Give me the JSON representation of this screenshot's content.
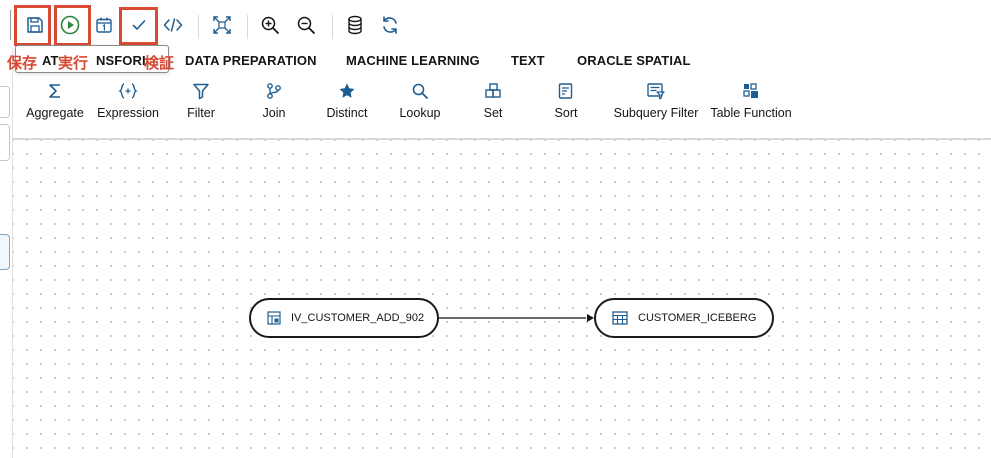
{
  "annotations": {
    "save": "保存",
    "run": "実行",
    "validate": "検証"
  },
  "tabs": [
    "AT",
    "NSFORI",
    "DATA PREPARATION",
    "MACHINE LEARNING",
    "TEXT",
    "ORACLE SPATIAL"
  ],
  "palette": [
    {
      "label": "Aggregate",
      "icon": "sigma-icon"
    },
    {
      "label": "Expression",
      "icon": "expression-icon"
    },
    {
      "label": "Filter",
      "icon": "filter-icon"
    },
    {
      "label": "Join",
      "icon": "join-icon"
    },
    {
      "label": "Distinct",
      "icon": "star-icon"
    },
    {
      "label": "Lookup",
      "icon": "search-icon"
    },
    {
      "label": "Set",
      "icon": "set-icon"
    },
    {
      "label": "Sort",
      "icon": "sort-icon"
    },
    {
      "label": "Subquery Filter",
      "icon": "subquery-filter-icon"
    },
    {
      "label": "Table Function",
      "icon": "table-function-icon"
    }
  ],
  "nodes": {
    "source": "IV_CUSTOMER_ADD_902",
    "target": "CUSTOMER_ICEBERG"
  },
  "colors": {
    "accent": "#1f5e91",
    "highlight": "#d84a34",
    "run": "#2e8540"
  },
  "toolbar_icons": [
    "save-icon",
    "run-icon",
    "schedule-icon",
    "validate-icon",
    "code-icon",
    "fit-icon",
    "zoom-in-icon",
    "zoom-out-icon",
    "database-icon",
    "refresh-icon"
  ]
}
